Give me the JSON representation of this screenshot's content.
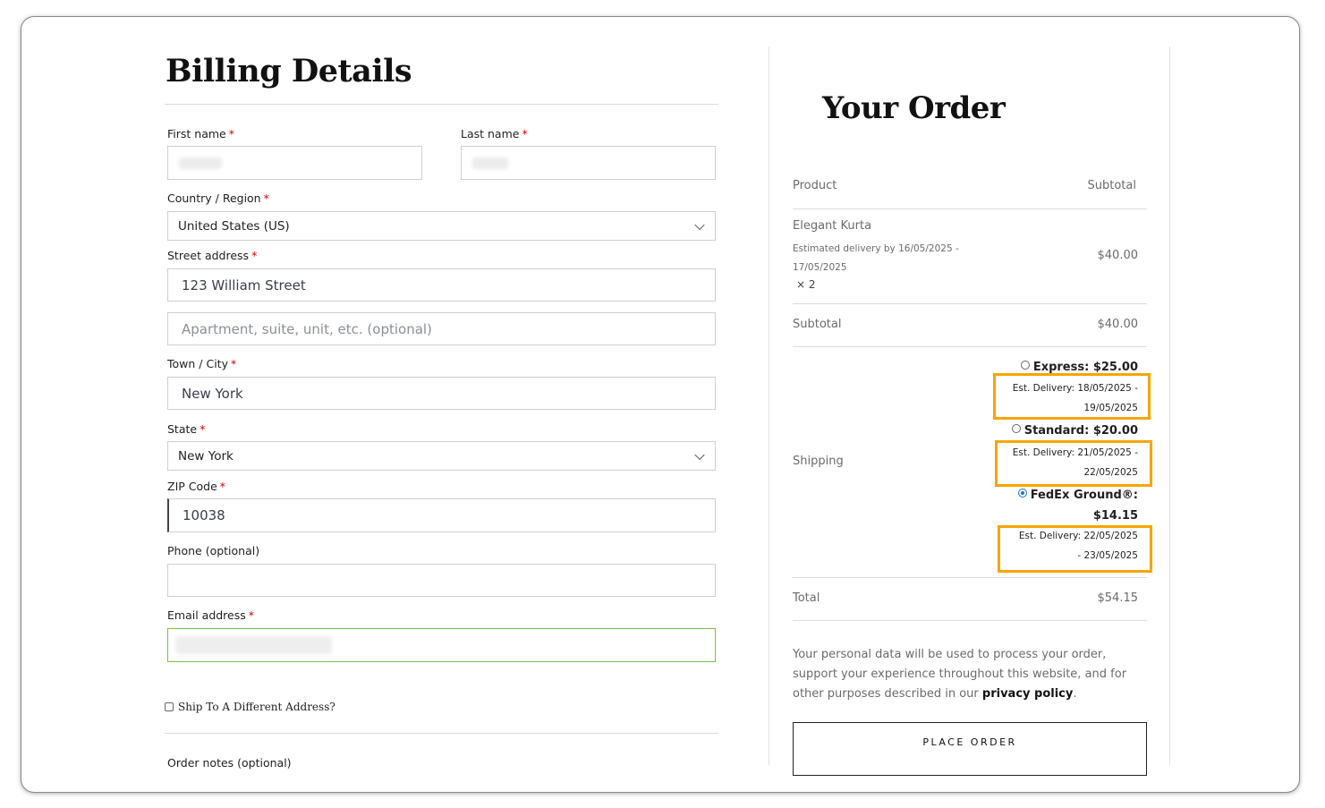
{
  "billing": {
    "title": "Billing Details",
    "first_name_label": "First name",
    "last_name_label": "Last name",
    "country_label": "Country / Region",
    "country_value": "United States (US)",
    "street_label": "Street address",
    "street_value": "123 William Street",
    "apartment_placeholder": "Apartment, suite, unit, etc. (optional)",
    "city_label": "Town / City",
    "city_value": "New York",
    "state_label": "State",
    "state_value": "New York",
    "zip_label": "ZIP Code",
    "zip_value": "10038",
    "phone_label": "Phone (optional)",
    "email_label": "Email address",
    "required_mark": "*",
    "ship_different_label": "Ship To A Different Address?",
    "order_notes_label": "Order notes (optional)"
  },
  "order": {
    "title": "Your Order",
    "product_header": "Product",
    "subtotal_header": "Subtotal",
    "item_name": "Elegant Kurta",
    "item_delivery_line1": "Estimated delivery by 16/05/2025 -",
    "item_delivery_line2": "17/05/2025",
    "item_qty": "× 2",
    "item_price": "$40.00",
    "subtotal_label": "Subtotal",
    "subtotal_value": "$40.00",
    "shipping_label": "Shipping",
    "shipping_options": [
      {
        "label": "Express: $25.00",
        "est1": "Est. Delivery: 18/05/2025 -",
        "est2": "19/05/2025",
        "selected": false
      },
      {
        "label": "Standard: $20.00",
        "est1": "Est. Delivery: 21/05/2025 -",
        "est2": "22/05/2025",
        "selected": false
      },
      {
        "label": "FedEx Ground®:",
        "label2": "$14.15",
        "est1": "Est. Delivery: 22/05/2025",
        "est2": "- 23/05/2025",
        "selected": true
      }
    ],
    "total_label": "Total",
    "total_value": "$54.15",
    "privacy_text_1": "Your personal data will be used to process your order,",
    "privacy_text_2": "support your experience throughout this website, and for",
    "privacy_text_3": "other purposes described in our",
    "privacy_link": "privacy policy",
    "privacy_period": ".",
    "place_order_label": "PLACE ORDER"
  },
  "colors": {
    "highlight": "#f6a500",
    "required": "#d10000",
    "valid_border": "#7ac142",
    "radio_selected": "#1a73e8"
  }
}
